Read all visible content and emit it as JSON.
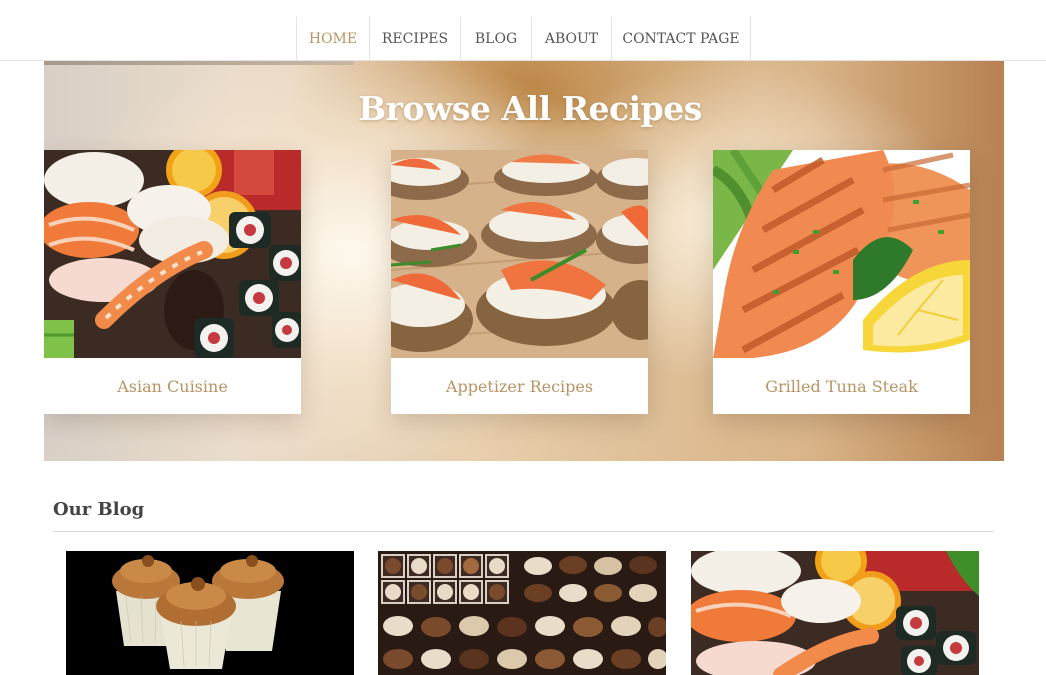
{
  "nav": {
    "items": [
      {
        "label": "HOME",
        "active": true
      },
      {
        "label": "RECIPES"
      },
      {
        "label": "BLOG"
      },
      {
        "label": "ABOUT"
      },
      {
        "label": "CONTACT PAGE"
      }
    ],
    "active_color": "#b89463"
  },
  "hero": {
    "title": "Browse All Recipes",
    "cards": [
      {
        "label": "Asian Cuisine",
        "image": "sushi-platter-image"
      },
      {
        "label": "Appetizer Recipes",
        "image": "salmon-canapes-image"
      },
      {
        "label": "Grilled Tuna Steak",
        "image": "grilled-salmon-lemon-image"
      }
    ]
  },
  "blog": {
    "heading": "Our Blog",
    "thumbnails": [
      {
        "image": "caramel-cupcakes-image"
      },
      {
        "image": "chocolate-box-image"
      },
      {
        "image": "sushi-platter-image"
      }
    ]
  }
}
